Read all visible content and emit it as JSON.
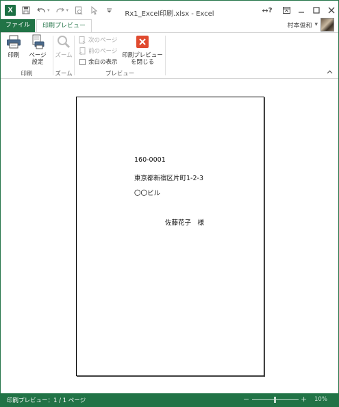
{
  "window": {
    "title": "Rx1_Excel印刷.xlsx - Excel",
    "help_label": "?",
    "controls": {
      "restore_ribbon": "▭",
      "minimize": "—",
      "maximize": "☐",
      "close": "✕"
    }
  },
  "tabs": {
    "file": "ファイル",
    "print_preview": "印刷プレビュー"
  },
  "user": {
    "name": "村本俊和",
    "dropdown": "▾"
  },
  "ribbon": {
    "print_group": {
      "label": "印刷",
      "print": "印刷",
      "page_setup_line1": "ページ",
      "page_setup_line2": "設定"
    },
    "zoom_group": {
      "label": "ズーム",
      "zoom": "ズーム"
    },
    "preview_group": {
      "label": "プレビュー",
      "next_page": "次のページ",
      "prev_page": "前のページ",
      "show_margins": "余白の表示",
      "close_line1": "印刷プレビュー",
      "close_line2": "を閉じる"
    }
  },
  "document": {
    "postal_code": "160-0001",
    "address": "東京都新宿区片町1-2-3",
    "building": "〇〇ビル",
    "recipient": "佐藤花子　様"
  },
  "status": {
    "text": "印刷プレビュー：1 / 1 ページ",
    "zoom_minus": "−",
    "zoom_plus": "+",
    "zoom_level": "10%"
  },
  "colors": {
    "accent": "#217346",
    "close_icon": "#e04a2f"
  }
}
